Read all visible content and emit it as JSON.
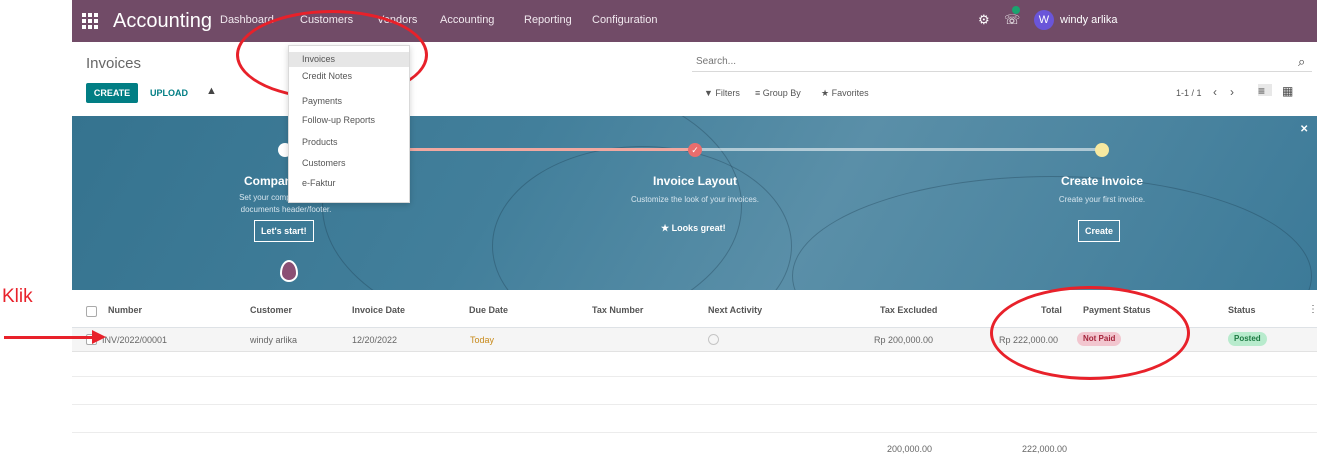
{
  "navbar": {
    "app_name": "Accounting",
    "menu": [
      "Dashboard",
      "Customers",
      "Vendors",
      "Accounting",
      "Reporting",
      "Configuration"
    ],
    "user_initial": "W",
    "user_name": "windy arlika",
    "bug_icon": "bug-icon",
    "chat_icon": "chat-icon"
  },
  "control_panel": {
    "breadcrumb": "Invoices",
    "create_label": "CREATE",
    "upload_label": "UPLOAD",
    "search_placeholder": "Search...",
    "filters_label": "▼ Filters",
    "groupby_label": "≡ Group By",
    "favorites_label": "★ Favorites",
    "pager": "1-1 / 1"
  },
  "customers_dropdown": {
    "items": [
      "Invoices",
      "Credit Notes",
      "Payments",
      "Follow-up Reports",
      "Products",
      "Customers",
      "e-Faktur"
    ],
    "active_index": 0
  },
  "onboarding": {
    "steps": [
      {
        "title": "Company Data",
        "description_line1": "Set your company data for",
        "description_line2": "documents header/footer.",
        "button": "Let's start!",
        "state": "todo"
      },
      {
        "title": "Invoice Layout",
        "description_line1": "Customize the look of your invoices.",
        "description_line2": "",
        "button": "★ Looks great!",
        "state": "done"
      },
      {
        "title": "Create Invoice",
        "description_line1": "Create your first invoice.",
        "description_line2": "",
        "button": "Create",
        "state": "todo"
      }
    ],
    "close_glyph": "✕"
  },
  "table": {
    "columns": [
      "Number",
      "Customer",
      "Invoice Date",
      "Due Date",
      "Tax Number",
      "Next Activity",
      "Tax Excluded",
      "Total",
      "Payment Status",
      "Status"
    ],
    "rows": [
      {
        "number": "INV/2022/00001",
        "customer": "windy arlika",
        "invoice_date": "12/20/2022",
        "due_date": "Today",
        "tax_number": "",
        "next_activity": "",
        "tax_excluded": "Rp 200,000.00",
        "total": "Rp 222,000.00",
        "payment_status": "Not Paid",
        "status": "Posted"
      }
    ],
    "footer": {
      "tax_excluded": "200,000.00",
      "total": "222,000.00"
    }
  },
  "annotations": {
    "label": "Klik",
    "color": "#e8212a"
  },
  "colors": {
    "navbar": "#714b67",
    "primary_button": "#017e84",
    "not_paid_bg": "#f2c6cf",
    "not_paid_text": "#a4243b",
    "posted_bg": "#b8ebcd",
    "posted_text": "#1d7a42",
    "due_today_text": "#c88a1b"
  }
}
